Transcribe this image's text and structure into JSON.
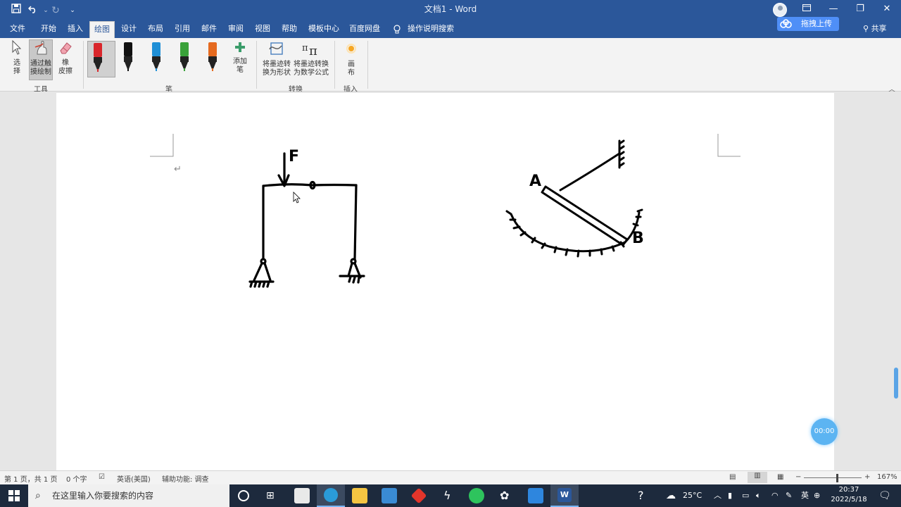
{
  "titlebar": {
    "doc_title": "文档1 - Word",
    "upload_label": "拖拽上传",
    "share_label": "共享"
  },
  "menu": {
    "tabs": [
      "文件",
      "开始",
      "插入",
      "绘图",
      "设计",
      "布局",
      "引用",
      "邮件",
      "审阅",
      "视图",
      "帮助",
      "模板中心",
      "百度网盘"
    ],
    "active_tab": "绘图",
    "tell_me": "操作说明搜索"
  },
  "ribbon": {
    "tools": {
      "select": "选\n择",
      "draw_touch": "通过触\n摸绘制",
      "eraser": "橡\n皮擦",
      "group_label": "工具"
    },
    "pens": {
      "colors": [
        "#d9262b",
        "#111111",
        "#1f8fd6",
        "#3aa23a",
        "#e56a1f"
      ],
      "add_pen": "添加\n笔",
      "group_label": "笔"
    },
    "convert": {
      "ink_to_shape": "将墨迹转\n换为形状",
      "ink_to_math": "将墨迹转换\n为数学公式",
      "group_label": "转换"
    },
    "insert": {
      "canvas": "画\n布",
      "group_label": "插入"
    }
  },
  "drawing": {
    "label_force": "F",
    "label_a": "A",
    "label_b": "B"
  },
  "timer_label": "00:00",
  "statusbar": {
    "page_info": "第 1 页，共 1 页",
    "word_count": "0 个字",
    "language": "英语(美国)",
    "accessibility": "辅助功能: 调查",
    "zoom": "167%"
  },
  "taskbar": {
    "search_placeholder": "在这里输入你要搜索的内容",
    "weather": "25°C",
    "ime": "英",
    "time": "20:37",
    "date": "2022/5/18"
  }
}
